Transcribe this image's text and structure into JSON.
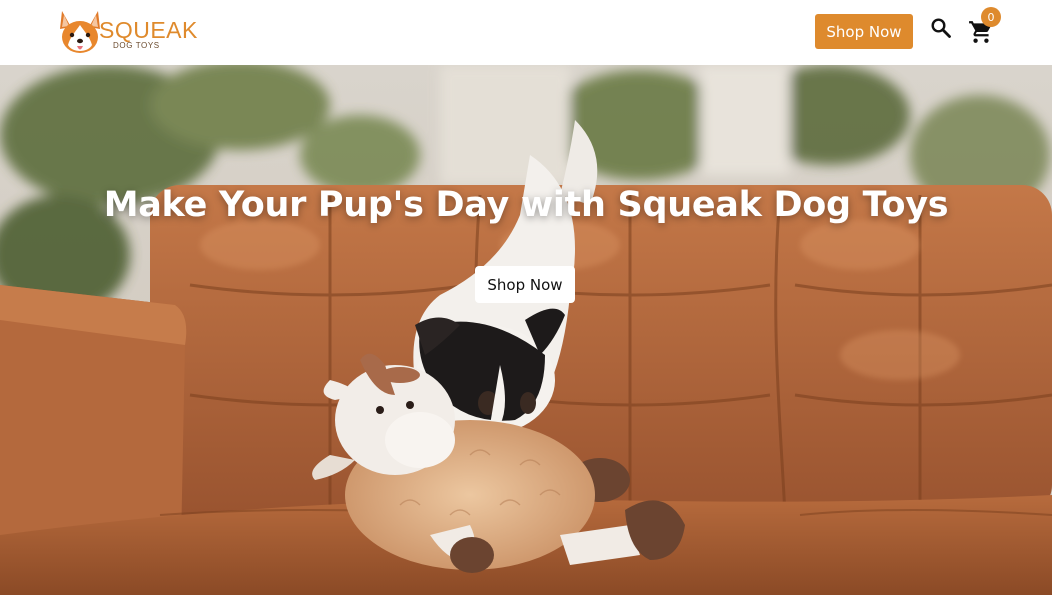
{
  "brand": {
    "name": "SQUEAK",
    "tagline": "DOG TOYS"
  },
  "header": {
    "shop_now_label": "Shop Now",
    "search_icon": "search-icon",
    "cart_icon": "shopping-cart-icon",
    "cart_count": "0"
  },
  "hero": {
    "title": "Make Your Pup's Day with Squeak Dog Toys",
    "cta_label": "Shop Now",
    "image": "puppy-with-plush-cow-toy-on-leather-sofa"
  },
  "colors": {
    "accent": "#de8a2d",
    "header_bg": "#ffffff",
    "sofa_leather": "#b5673a",
    "hero_text": "#ffffff"
  }
}
